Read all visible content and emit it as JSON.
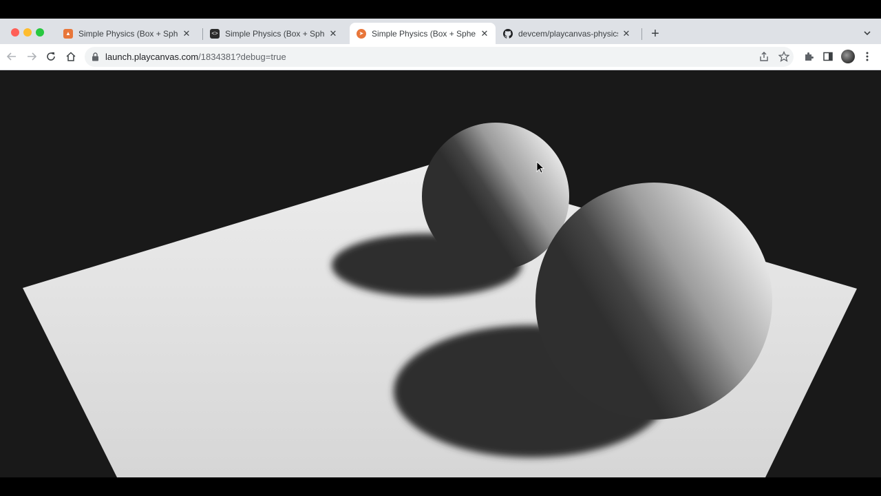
{
  "tabs": [
    {
      "title": "Simple Physics (Box + Sphere)",
      "favicon": "playcanvas-editor-icon",
      "active": false
    },
    {
      "title": "Simple Physics (Box + Sphere)",
      "favicon": "code-editor-icon",
      "active": false
    },
    {
      "title": "Simple Physics (Box + Sphere)",
      "favicon": "playcanvas-launch-icon",
      "active": true
    },
    {
      "title": "devcem/playcanvas-physics: S",
      "favicon": "github-icon",
      "active": false
    }
  ],
  "address_bar": {
    "host": "launch.playcanvas.com",
    "path": "/1834381?debug=true"
  },
  "colors": {
    "chrome_bg": "#dee1e6",
    "viewport_bg": "#191919",
    "floor": "#e2e2e2",
    "shadow": "#2e2e2e"
  }
}
